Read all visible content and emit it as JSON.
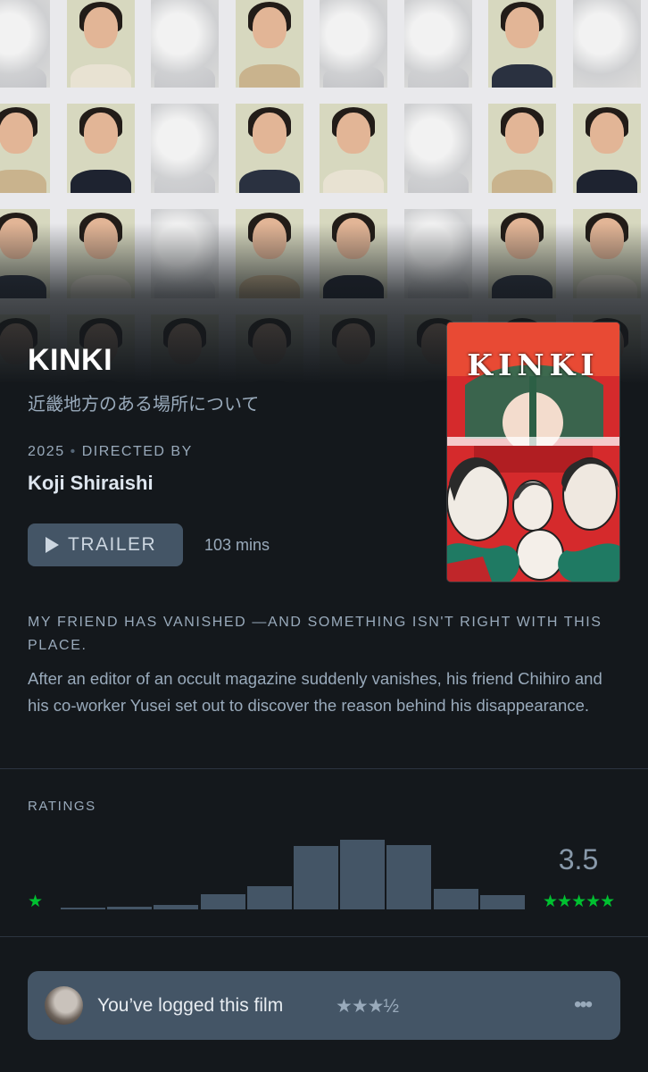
{
  "film": {
    "title": "KINKI",
    "original_title": "近畿地方のある場所について",
    "year": "2025",
    "meta_separator": "•",
    "directed_by_label": "DIRECTED BY",
    "director": "Koji Shiraishi",
    "trailer_label": "TRAILER",
    "runtime": "103 mins",
    "poster_title": "KINKI",
    "tagline": "MY FRIEND HAS VANISHED —AND SOMETHING ISN'T RIGHT WITH THIS PLACE.",
    "synopsis": "After an editor of an occult magazine suddenly vanishes, his friend Chihiro and his co-worker Yusei set out to discover the reason behind his disappearance."
  },
  "ratings": {
    "label": "RATINGS",
    "average": "3.5",
    "min_star": "★",
    "max_stars": "★★★★★",
    "histogram": [
      0.02,
      0.04,
      0.06,
      0.22,
      0.33,
      0.91,
      1.0,
      0.92,
      0.29,
      0.2
    ]
  },
  "logged": {
    "text": "You’ve logged this film",
    "rating": "★★★½",
    "more_icon": "•••"
  },
  "colors": {
    "background": "#14181c",
    "accent_green": "#00c030",
    "bar": "#445566",
    "muted_text": "#99aabb"
  },
  "icons": [
    "play-icon",
    "star-icon",
    "more-icon",
    "avatar"
  ]
}
